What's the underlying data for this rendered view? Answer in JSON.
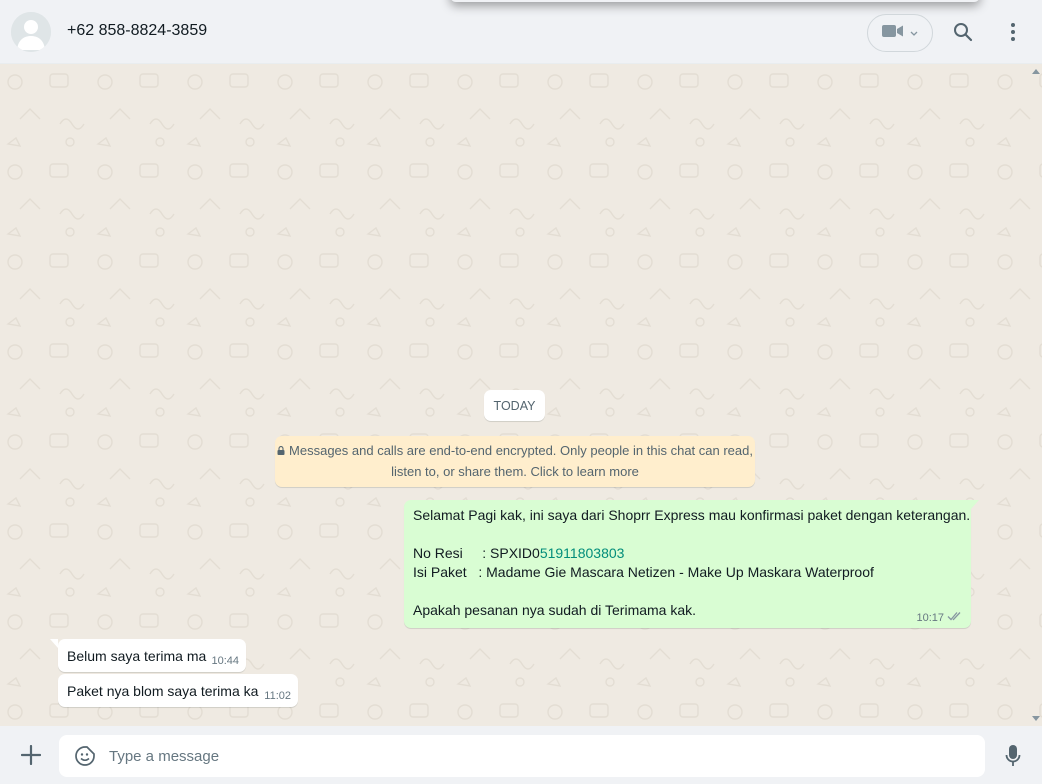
{
  "header": {
    "contact_name": "+62 858-8824-3859",
    "icons": [
      "avatar-default-icon",
      "video-call-icon",
      "chevron-down-icon",
      "search-icon",
      "menu-icon"
    ]
  },
  "chat": {
    "date_chip": "TODAY",
    "encryption_notice": {
      "line1": "Messages and calls are end-to-end encrypted. Only people in this chat can read,",
      "line2": "listen to, or share them. Click to learn more"
    },
    "outgoing": {
      "line1": "Selamat Pagi kak, ini saya dari Shoprr Express mau konfirmasi paket dengan keterangan.",
      "resi_label": "No Resi     : SPXID0",
      "resi_link": "51911803803",
      "paket_line": "Isi Paket   : Madame Gie Mascara Netizen - Make Up Maskara Waterproof",
      "question": "Apakah pesanan nya sudah di Terimama kak.",
      "time": "10:17",
      "status": "read"
    },
    "incoming": [
      {
        "text": "Belum saya terima ma",
        "time": "10:44"
      },
      {
        "text": "Paket nya blom saya terima ka",
        "time": "11:02"
      }
    ]
  },
  "composer": {
    "placeholder": "Type a message",
    "icons": [
      "plus-icon",
      "sticker-icon",
      "microphone-icon"
    ]
  },
  "colors": {
    "outgoing_bubble": "#d9fdd3",
    "incoming_bubble": "#ffffff",
    "chat_background": "#efeae2",
    "header_background": "#f0f2f5",
    "encryption_notice": "#ffeecd",
    "link_green": "#028d7a"
  }
}
